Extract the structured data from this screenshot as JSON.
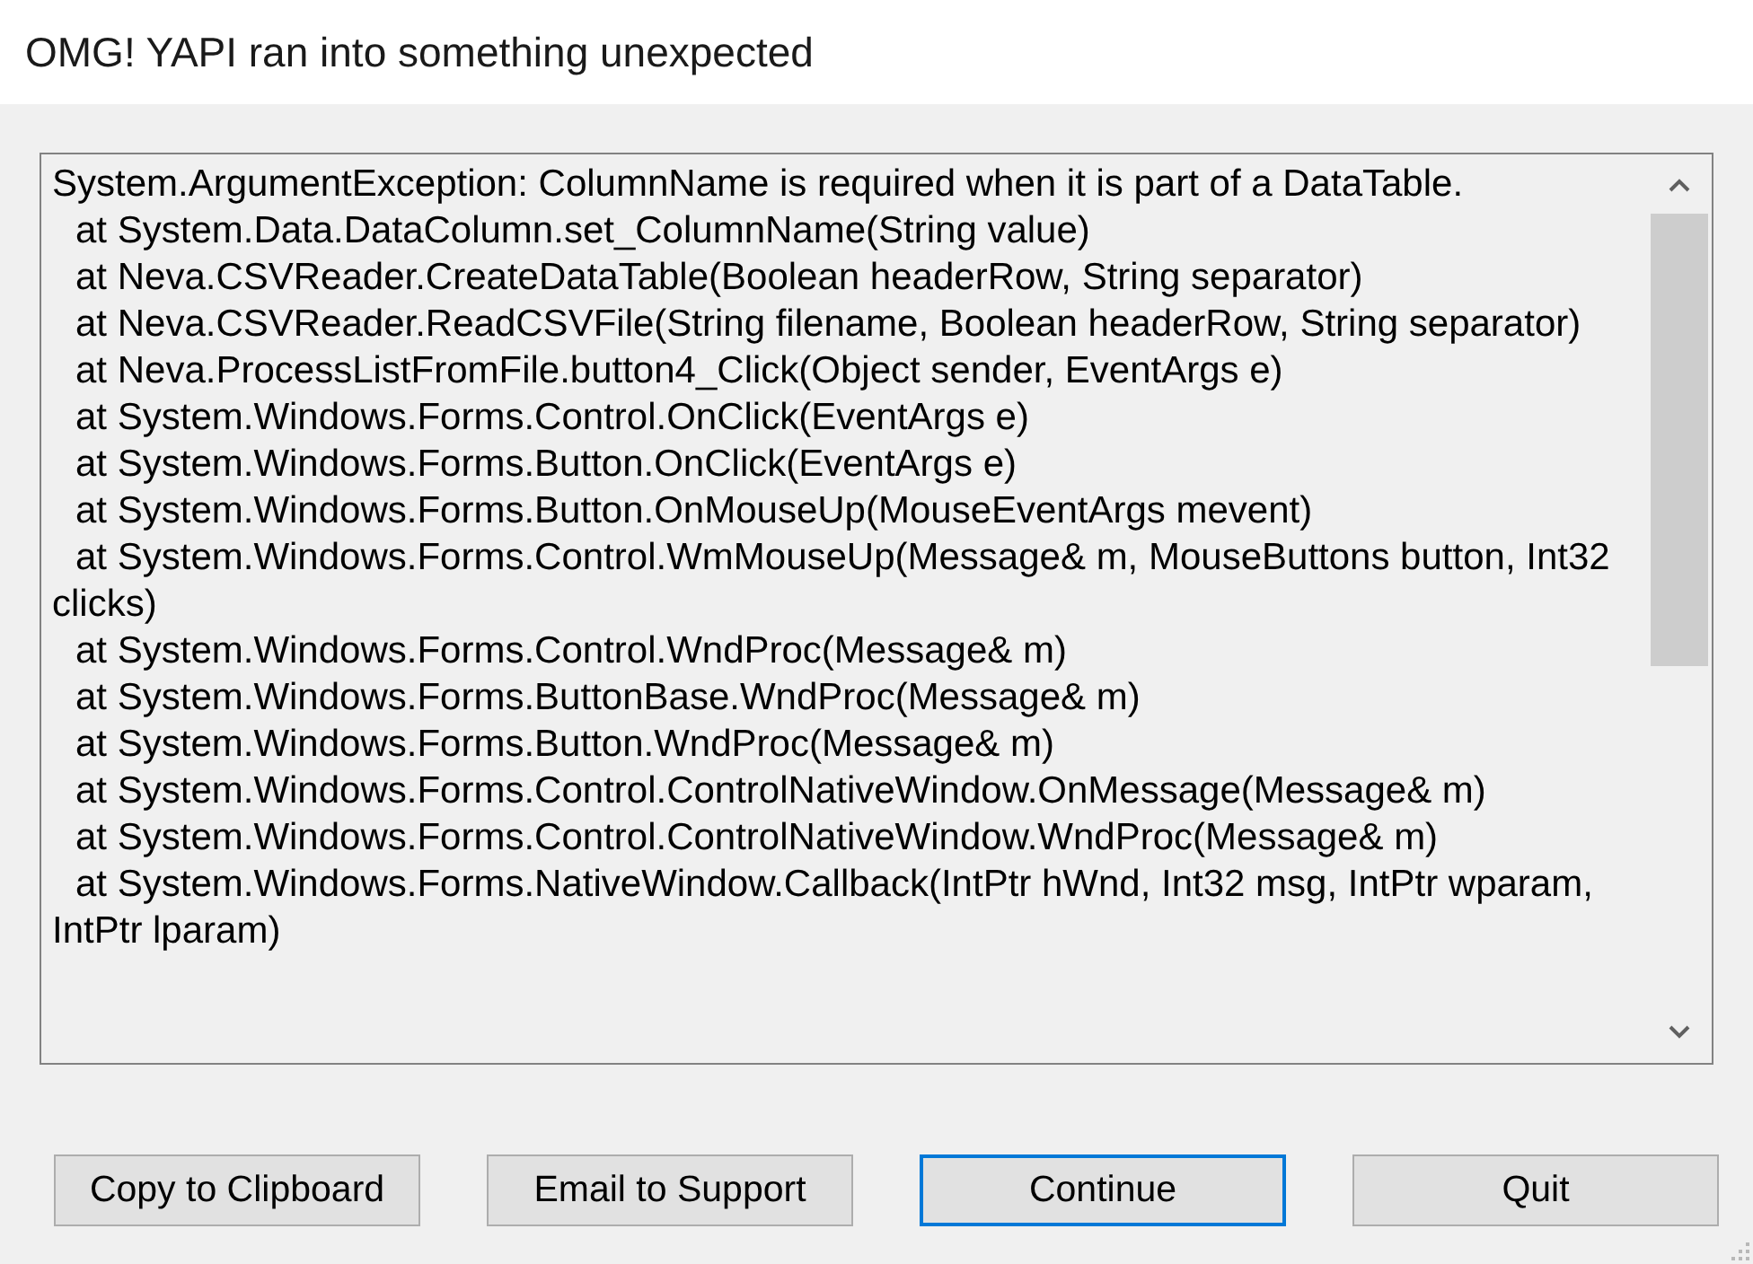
{
  "window": {
    "title": "OMG! YAPI ran into something unexpected"
  },
  "error_details": {
    "lines": [
      {
        "text": "System.ArgumentException: ColumnName is required when it is part of a DataTable.",
        "kind": "message"
      },
      {
        "text": "at System.Data.DataColumn.set_ColumnName(String value)",
        "kind": "frame"
      },
      {
        "text": "at Neva.CSVReader.CreateDataTable(Boolean headerRow, String separator)",
        "kind": "frame"
      },
      {
        "text": "at Neva.CSVReader.ReadCSVFile(String filename, Boolean headerRow, String separator)",
        "kind": "frame"
      },
      {
        "text": "at Neva.ProcessListFromFile.button4_Click(Object sender, EventArgs e)",
        "kind": "frame"
      },
      {
        "text": "at System.Windows.Forms.Control.OnClick(EventArgs e)",
        "kind": "frame"
      },
      {
        "text": "at System.Windows.Forms.Button.OnClick(EventArgs e)",
        "kind": "frame"
      },
      {
        "text": "at System.Windows.Forms.Button.OnMouseUp(MouseEventArgs mevent)",
        "kind": "frame"
      },
      {
        "text": "at System.Windows.Forms.Control.WmMouseUp(Message& m, MouseButtons button, Int32",
        "kind": "frame"
      },
      {
        "text": "clicks)",
        "kind": "wrap"
      },
      {
        "text": "at System.Windows.Forms.Control.WndProc(Message& m)",
        "kind": "frame"
      },
      {
        "text": "at System.Windows.Forms.ButtonBase.WndProc(Message& m)",
        "kind": "frame"
      },
      {
        "text": "at System.Windows.Forms.Button.WndProc(Message& m)",
        "kind": "frame"
      },
      {
        "text": "at System.Windows.Forms.Control.ControlNativeWindow.OnMessage(Message& m)",
        "kind": "frame"
      },
      {
        "text": "at System.Windows.Forms.Control.ControlNativeWindow.WndProc(Message& m)",
        "kind": "frame"
      },
      {
        "text": "at System.Windows.Forms.NativeWindow.Callback(IntPtr hWnd, Int32 msg, IntPtr wparam,",
        "kind": "frame"
      },
      {
        "text": "IntPtr lparam)",
        "kind": "wrap"
      }
    ]
  },
  "buttons": [
    {
      "label": "Copy to Clipboard",
      "default": false
    },
    {
      "label": "Email to Support",
      "default": false
    },
    {
      "label": "Continue",
      "default": true
    },
    {
      "label": "Quit",
      "default": false
    }
  ]
}
